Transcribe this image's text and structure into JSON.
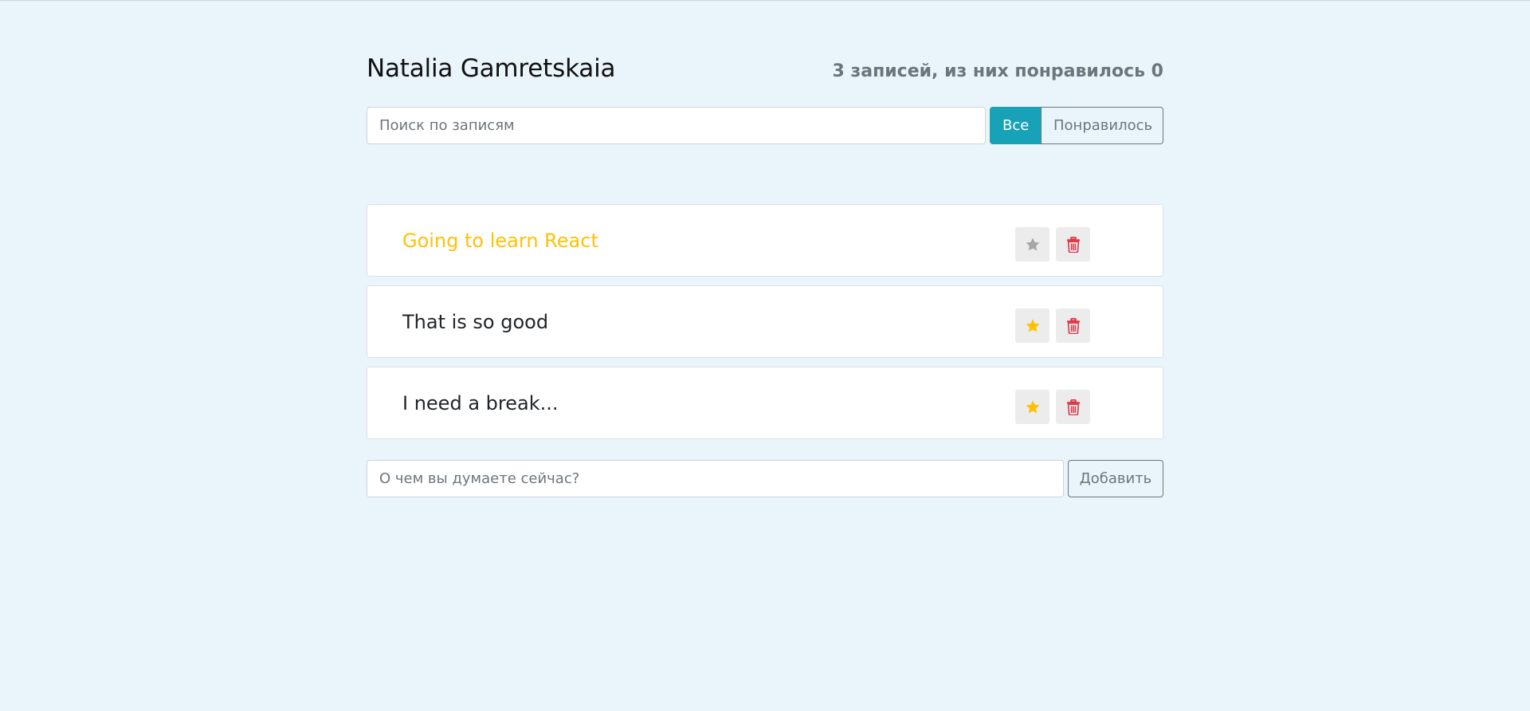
{
  "header": {
    "name": "Natalia Gamretskaia",
    "stats": "3 записей, из них понравилось 0"
  },
  "search": {
    "placeholder": "Поиск по записям",
    "value": ""
  },
  "filter": {
    "all_label": "Все",
    "liked_label": "Понравилось",
    "active": "all"
  },
  "posts": [
    {
      "label": "Going to learn React",
      "important": true,
      "star_icon": "star-icon",
      "star_color": "#a6a6a6",
      "delete_icon": "trash-icon"
    },
    {
      "label": "That is so good",
      "important": false,
      "star_icon": "star-icon",
      "star_color": "#ffc107",
      "delete_icon": "trash-icon"
    },
    {
      "label": "I need a break...",
      "important": false,
      "star_icon": "star-icon",
      "star_color": "#ffc107",
      "delete_icon": "trash-icon"
    }
  ],
  "add_form": {
    "placeholder": "О чем вы думаете сейчас?",
    "value": "",
    "button_label": "Добавить"
  },
  "colors": {
    "background": "#e9f5fb",
    "accent": "#17a2b8",
    "important_text": "#ffc107",
    "delete_icon": "#dc3545",
    "muted": "#6c757d"
  }
}
